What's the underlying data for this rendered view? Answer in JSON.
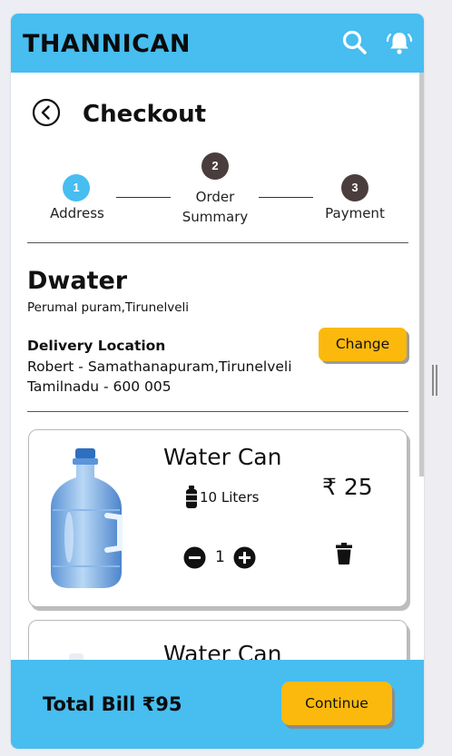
{
  "app": {
    "brand": "THANNICAN"
  },
  "colors": {
    "header": "#47bdf0",
    "accent_button": "#fbb90d",
    "step_active": "#47bdf0",
    "step_inactive": "#4a3d3d"
  },
  "header": {
    "search_icon": "search-icon",
    "bell_icon": "bell-icon"
  },
  "page": {
    "title": "Checkout",
    "back_icon": "back-circle-icon"
  },
  "steps": [
    {
      "number": "1",
      "label": "Address",
      "active": true
    },
    {
      "number": "2",
      "label_line1": "Order",
      "label_line2": "Summary",
      "active": false
    },
    {
      "number": "3",
      "label": "Payment",
      "active": false
    }
  ],
  "shop": {
    "name": "Dwater",
    "address": "Perumal puram,Tirunelveli"
  },
  "delivery": {
    "title": "Delivery Location",
    "line1": "Robert - Samathanapuram,Tirunelveli",
    "line2": "Tamilnadu - 600 005",
    "change_label": "Change"
  },
  "cart": [
    {
      "name": "Water Can",
      "size": "10 Liters",
      "price": "₹ 25",
      "qty": "1"
    },
    {
      "name": "Water Can"
    }
  ],
  "footer": {
    "total": "Total Bill ₹95",
    "continue_label": "Continue"
  }
}
